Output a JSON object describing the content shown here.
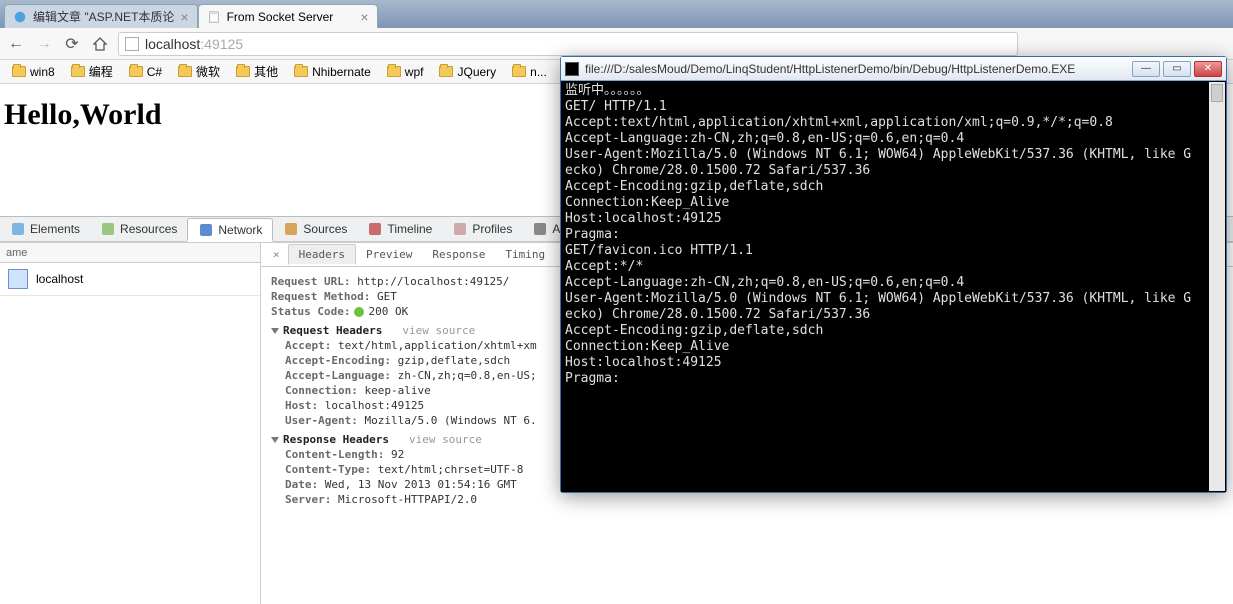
{
  "browser": {
    "tabs": [
      {
        "title": "编辑文章 \"ASP.NET本质论",
        "active": false
      },
      {
        "title": "From Socket Server",
        "active": true
      }
    ],
    "url_host": "localhost",
    "url_port": ":49125",
    "bookmarks": [
      "win8",
      "编程",
      "C#",
      "微软",
      "其他",
      "Nhibernate",
      "wpf",
      "JQuery",
      "n..."
    ]
  },
  "page": {
    "heading": "Hello,World"
  },
  "devtools": {
    "panels": [
      "Elements",
      "Resources",
      "Network",
      "Sources",
      "Timeline",
      "Profiles",
      "Au"
    ],
    "active_panel": "Network",
    "left_header": "ame",
    "requests": [
      {
        "name": "localhost"
      }
    ],
    "subtabs": [
      "Headers",
      "Preview",
      "Response",
      "Timing"
    ],
    "active_subtab": "Headers",
    "general": {
      "url_k": "Request URL:",
      "url_v": "http://localhost:49125/",
      "method_k": "Request Method:",
      "method_v": "GET",
      "status_k": "Status Code:",
      "status_v": "200 OK"
    },
    "req_hdr_title": "Request Headers",
    "view_source": "view source",
    "req_headers": [
      {
        "k": "Accept:",
        "v": "text/html,application/xhtml+xm"
      },
      {
        "k": "Accept-Encoding:",
        "v": "gzip,deflate,sdch"
      },
      {
        "k": "Accept-Language:",
        "v": "zh-CN,zh;q=0.8,en-US;"
      },
      {
        "k": "Connection:",
        "v": "keep-alive"
      },
      {
        "k": "Host:",
        "v": "localhost:49125"
      },
      {
        "k": "User-Agent:",
        "v": "Mozilla/5.0 (Windows NT 6."
      }
    ],
    "resp_hdr_title": "Response Headers",
    "resp_headers": [
      {
        "k": "Content-Length:",
        "v": "92"
      },
      {
        "k": "Content-Type:",
        "v": "text/html;chrset=UTF-8"
      },
      {
        "k": "Date:",
        "v": "Wed, 13 Nov 2013 01:54:16 GMT"
      },
      {
        "k": "Server:",
        "v": "Microsoft-HTTPAPI/2.0"
      }
    ]
  },
  "console": {
    "title": "file:///D:/salesMoud/Demo/LinqStudent/HttpListenerDemo/bin/Debug/HttpListenerDemo.EXE",
    "lines": [
      "监听中。。。。。。",
      "GET/ HTTP/1.1",
      "Accept:text/html,application/xhtml+xml,application/xml;q=0.9,*/*;q=0.8",
      "Accept-Language:zh-CN,zh;q=0.8,en-US;q=0.6,en;q=0.4",
      "User-Agent:Mozilla/5.0 (Windows NT 6.1; WOW64) AppleWebKit/537.36 (KHTML, like G",
      "ecko) Chrome/28.0.1500.72 Safari/537.36",
      "Accept-Encoding:gzip,deflate,sdch",
      "Connection:Keep_Alive",
      "Host:localhost:49125",
      "Pragma:",
      "GET/favicon.ico HTTP/1.1",
      "Accept:*/*",
      "Accept-Language:zh-CN,zh;q=0.8,en-US;q=0.6,en;q=0.4",
      "User-Agent:Mozilla/5.0 (Windows NT 6.1; WOW64) AppleWebKit/537.36 (KHTML, like G",
      "ecko) Chrome/28.0.1500.72 Safari/537.36",
      "Accept-Encoding:gzip,deflate,sdch",
      "Connection:Keep_Alive",
      "Host:localhost:49125",
      "Pragma:"
    ]
  }
}
